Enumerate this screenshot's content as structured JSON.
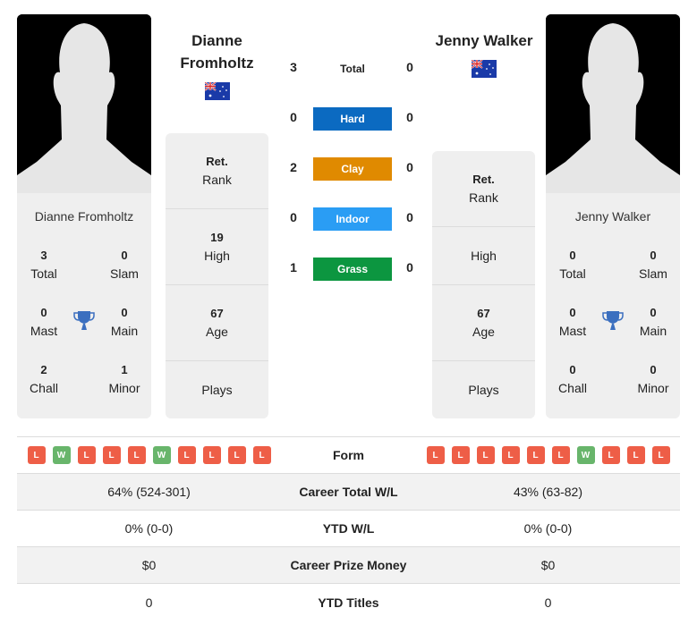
{
  "player1": {
    "name": "Dianne Fromholtz",
    "name_line1": "Dianne",
    "name_line2": "Fromholtz",
    "country_flag": "australia-flag",
    "titles": {
      "total": "3",
      "total_label": "Total",
      "slam": "0",
      "slam_label": "Slam",
      "mast": "0",
      "mast_label": "Mast",
      "main": "0",
      "main_label": "Main",
      "chall": "2",
      "chall_label": "Chall",
      "minor": "1",
      "minor_label": "Minor"
    },
    "rank_value": "Ret.",
    "rank_label": "Rank",
    "high_value": "19",
    "high_label": "High",
    "age_value": "67",
    "age_label": "Age",
    "plays_value": "",
    "plays_label": "Plays",
    "form": [
      "L",
      "W",
      "L",
      "L",
      "L",
      "W",
      "L",
      "L",
      "L",
      "L"
    ],
    "career_wl": "64% (524-301)",
    "ytd_wl": "0% (0-0)",
    "prize_money": "$0",
    "ytd_titles": "0"
  },
  "player2": {
    "name": "Jenny Walker",
    "country_flag": "australia-flag",
    "titles": {
      "total": "0",
      "total_label": "Total",
      "slam": "0",
      "slam_label": "Slam",
      "mast": "0",
      "mast_label": "Mast",
      "main": "0",
      "main_label": "Main",
      "chall": "0",
      "chall_label": "Chall",
      "minor": "0",
      "minor_label": "Minor"
    },
    "rank_value": "Ret.",
    "rank_label": "Rank",
    "high_value": "",
    "high_label": "High",
    "age_value": "67",
    "age_label": "Age",
    "plays_value": "",
    "plays_label": "Plays",
    "form": [
      "L",
      "L",
      "L",
      "L",
      "L",
      "L",
      "W",
      "L",
      "L",
      "L"
    ],
    "career_wl": "43% (63-82)",
    "ytd_wl": "0% (0-0)",
    "prize_money": "$0",
    "ytd_titles": "0"
  },
  "h2h": {
    "total": {
      "label": "Total",
      "p1": "3",
      "p2": "0"
    },
    "surfaces": [
      {
        "label": "Hard",
        "p1": "0",
        "p2": "0",
        "color": "#0b6ac1"
      },
      {
        "label": "Clay",
        "p1": "2",
        "p2": "0",
        "color": "#e08a00"
      },
      {
        "label": "Indoor",
        "p1": "0",
        "p2": "0",
        "color": "#2a9df4"
      },
      {
        "label": "Grass",
        "p1": "1",
        "p2": "0",
        "color": "#0c9640"
      }
    ]
  },
  "table": {
    "form_label": "Form",
    "career_label": "Career Total W/L",
    "ytd_label": "YTD W/L",
    "prize_label": "Career Prize Money",
    "titles_label": "YTD Titles"
  },
  "colors": {
    "loss": "#ee5e47",
    "win": "#68b56b",
    "trophy": "#3b6fbf"
  }
}
